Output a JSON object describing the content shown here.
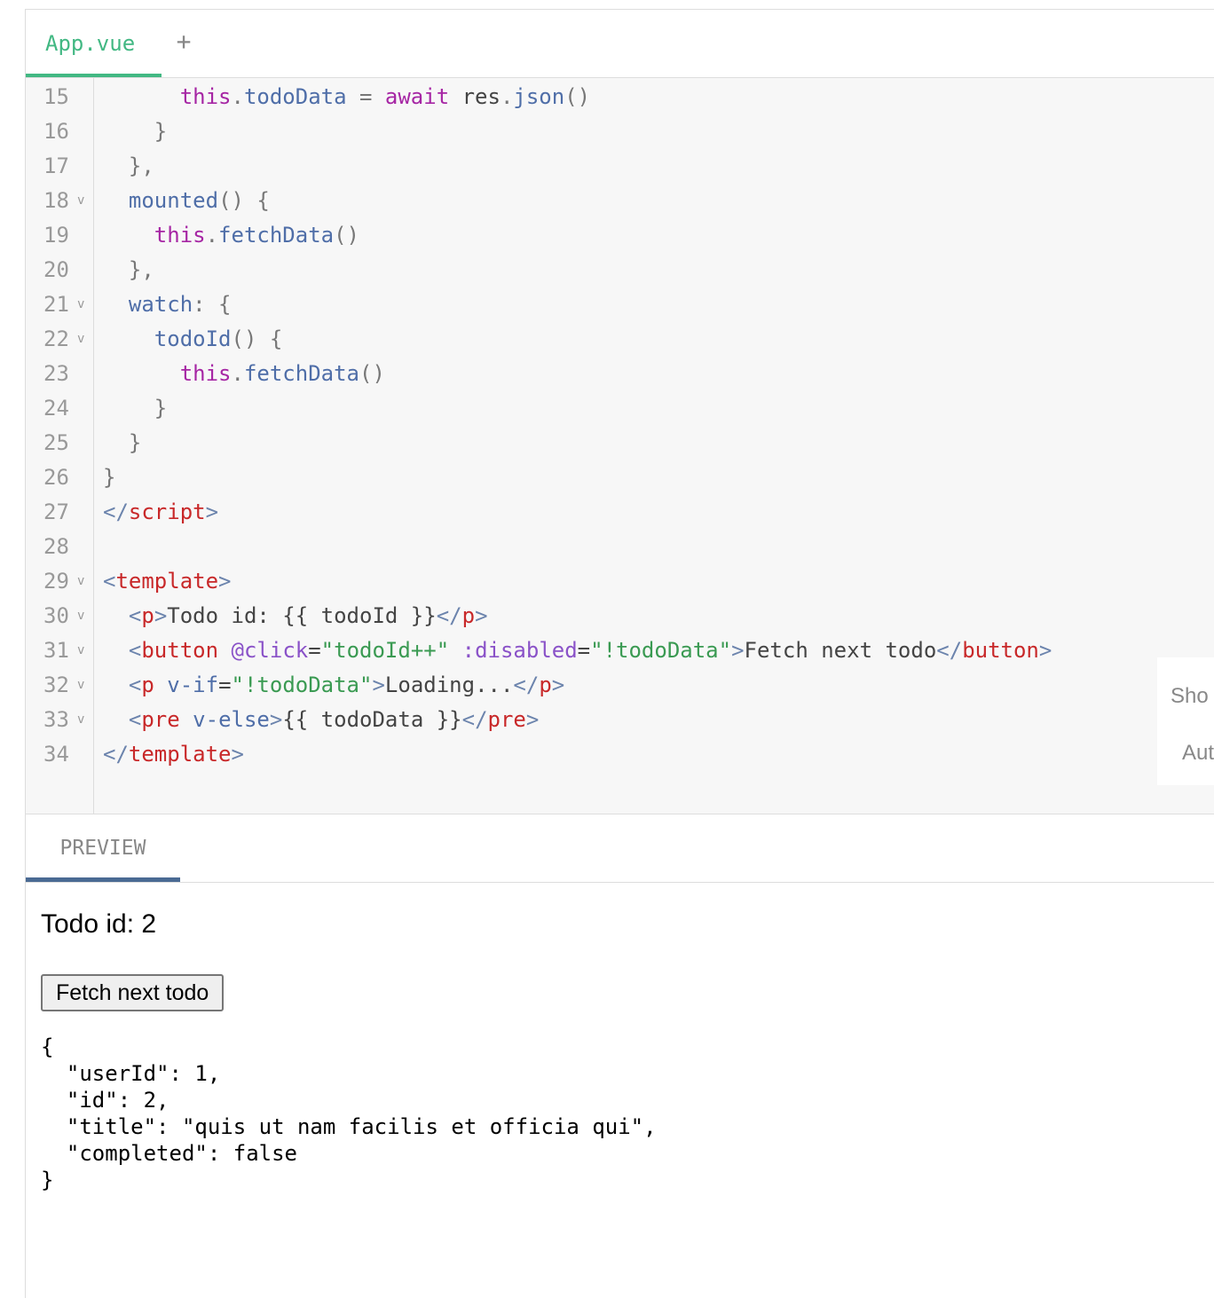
{
  "tabs": {
    "file_tab": "App.vue",
    "add_tab": "+"
  },
  "editor": {
    "lines": [
      {
        "n": "15",
        "fold": "",
        "tokens": [
          [
            "",
            "      "
          ],
          [
            "kw",
            "this"
          ],
          [
            "pun",
            "."
          ],
          [
            "prop",
            "todoData"
          ],
          [
            "pun",
            " = "
          ],
          [
            "kw2",
            "await"
          ],
          [
            "txt",
            " res"
          ],
          [
            "pun",
            "."
          ],
          [
            "fn",
            "json"
          ],
          [
            "pun",
            "()"
          ]
        ]
      },
      {
        "n": "16",
        "fold": "",
        "tokens": [
          [
            "",
            "    "
          ],
          [
            "pun",
            "}"
          ]
        ]
      },
      {
        "n": "17",
        "fold": "",
        "tokens": [
          [
            "",
            "  "
          ],
          [
            "pun",
            "},"
          ]
        ]
      },
      {
        "n": "18",
        "fold": "v",
        "tokens": [
          [
            "",
            "  "
          ],
          [
            "fn",
            "mounted"
          ],
          [
            "pun",
            "() {"
          ]
        ]
      },
      {
        "n": "19",
        "fold": "",
        "tokens": [
          [
            "",
            "    "
          ],
          [
            "kw",
            "this"
          ],
          [
            "pun",
            "."
          ],
          [
            "fn",
            "fetchData"
          ],
          [
            "pun",
            "()"
          ]
        ]
      },
      {
        "n": "20",
        "fold": "",
        "tokens": [
          [
            "",
            "  "
          ],
          [
            "pun",
            "},"
          ]
        ]
      },
      {
        "n": "21",
        "fold": "v",
        "tokens": [
          [
            "",
            "  "
          ],
          [
            "prop",
            "watch"
          ],
          [
            "pun",
            ": {"
          ]
        ]
      },
      {
        "n": "22",
        "fold": "v",
        "tokens": [
          [
            "",
            "    "
          ],
          [
            "fn",
            "todoId"
          ],
          [
            "pun",
            "() {"
          ]
        ]
      },
      {
        "n": "23",
        "fold": "",
        "tokens": [
          [
            "",
            "      "
          ],
          [
            "kw",
            "this"
          ],
          [
            "pun",
            "."
          ],
          [
            "fn",
            "fetchData"
          ],
          [
            "pun",
            "()"
          ]
        ]
      },
      {
        "n": "24",
        "fold": "",
        "tokens": [
          [
            "",
            "    "
          ],
          [
            "pun",
            "}"
          ]
        ]
      },
      {
        "n": "25",
        "fold": "",
        "tokens": [
          [
            "",
            "  "
          ],
          [
            "pun",
            "}"
          ]
        ]
      },
      {
        "n": "26",
        "fold": "",
        "tokens": [
          [
            "pun",
            "}"
          ]
        ]
      },
      {
        "n": "27",
        "fold": "",
        "tokens": [
          [
            "br",
            "</"
          ],
          [
            "tag",
            "script"
          ],
          [
            "br",
            ">"
          ]
        ]
      },
      {
        "n": "28",
        "fold": "",
        "tokens": []
      },
      {
        "n": "29",
        "fold": "v",
        "tokens": [
          [
            "br",
            "<"
          ],
          [
            "tag",
            "template"
          ],
          [
            "br",
            ">"
          ]
        ]
      },
      {
        "n": "30",
        "fold": "v",
        "tokens": [
          [
            "",
            "  "
          ],
          [
            "br",
            "<"
          ],
          [
            "tag",
            "p"
          ],
          [
            "br",
            ">"
          ],
          [
            "txt",
            "Todo id: {{ todoId }}"
          ],
          [
            "br",
            "</"
          ],
          [
            "tag",
            "p"
          ],
          [
            "br",
            ">"
          ]
        ]
      },
      {
        "n": "31",
        "fold": "v",
        "tokens": [
          [
            "",
            "  "
          ],
          [
            "br",
            "<"
          ],
          [
            "tag",
            "button"
          ],
          [
            "txt",
            " "
          ],
          [
            "dir",
            "@click"
          ],
          [
            "txt",
            "="
          ],
          [
            "str",
            "\"todoId++\""
          ],
          [
            "txt",
            " "
          ],
          [
            "dir",
            ":disabled"
          ],
          [
            "txt",
            "="
          ],
          [
            "str",
            "\"!todoData\""
          ],
          [
            "br",
            ">"
          ],
          [
            "txt",
            "Fetch next todo"
          ],
          [
            "br",
            "</"
          ],
          [
            "tag",
            "button"
          ],
          [
            "br",
            ">"
          ]
        ]
      },
      {
        "n": "32",
        "fold": "v",
        "tokens": [
          [
            "",
            "  "
          ],
          [
            "br",
            "<"
          ],
          [
            "tag",
            "p"
          ],
          [
            "txt",
            " "
          ],
          [
            "attr",
            "v-if"
          ],
          [
            "txt",
            "="
          ],
          [
            "str",
            "\"!todoData\""
          ],
          [
            "br",
            ">"
          ],
          [
            "txt",
            "Loading..."
          ],
          [
            "br",
            "</"
          ],
          [
            "tag",
            "p"
          ],
          [
            "br",
            ">"
          ]
        ]
      },
      {
        "n": "33",
        "fold": "v",
        "tokens": [
          [
            "",
            "  "
          ],
          [
            "br",
            "<"
          ],
          [
            "tag",
            "pre"
          ],
          [
            "txt",
            " "
          ],
          [
            "attr",
            "v-else"
          ],
          [
            "br",
            ">"
          ],
          [
            "txt",
            "{{ todoData }}"
          ],
          [
            "br",
            "</"
          ],
          [
            "tag",
            "pre"
          ],
          [
            "br",
            ">"
          ]
        ]
      },
      {
        "n": "34",
        "fold": "",
        "tokens": [
          [
            "br",
            "</"
          ],
          [
            "tag",
            "template"
          ],
          [
            "br",
            ">"
          ]
        ]
      }
    ]
  },
  "side_hint": {
    "line1": "Sho",
    "line2": "Aut"
  },
  "preview": {
    "tab_label": "PREVIEW",
    "title": "Todo id: 2",
    "button_label": "Fetch next todo",
    "output": "{\n  \"userId\": 1,\n  \"id\": 2,\n  \"title\": \"quis ut nam facilis et officia qui\",\n  \"completed\": false\n}"
  }
}
